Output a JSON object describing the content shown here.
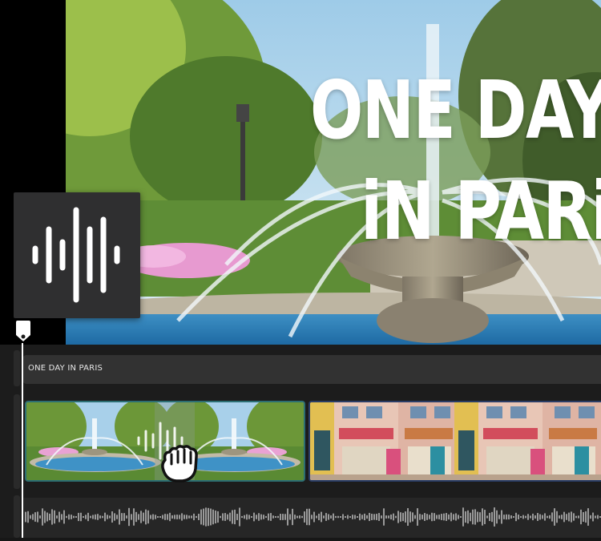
{
  "preview": {
    "title_line1": "ONE DAY",
    "title_line2": "iN PARiS"
  },
  "timeline": {
    "text_track_label": "ONE DAY IN PARIS"
  },
  "icons": {
    "audio_tile": "audio-waveform-icon",
    "playhead": "playhead-marker-icon",
    "cursor": "grab-hand-cursor-icon"
  },
  "colors": {
    "timeline_bg": "#1c1c1c",
    "text_track": "#323232",
    "clip1_border": "#2c6e73",
    "clip2_border": "#2a3d66",
    "playhead": "#ffffff"
  }
}
